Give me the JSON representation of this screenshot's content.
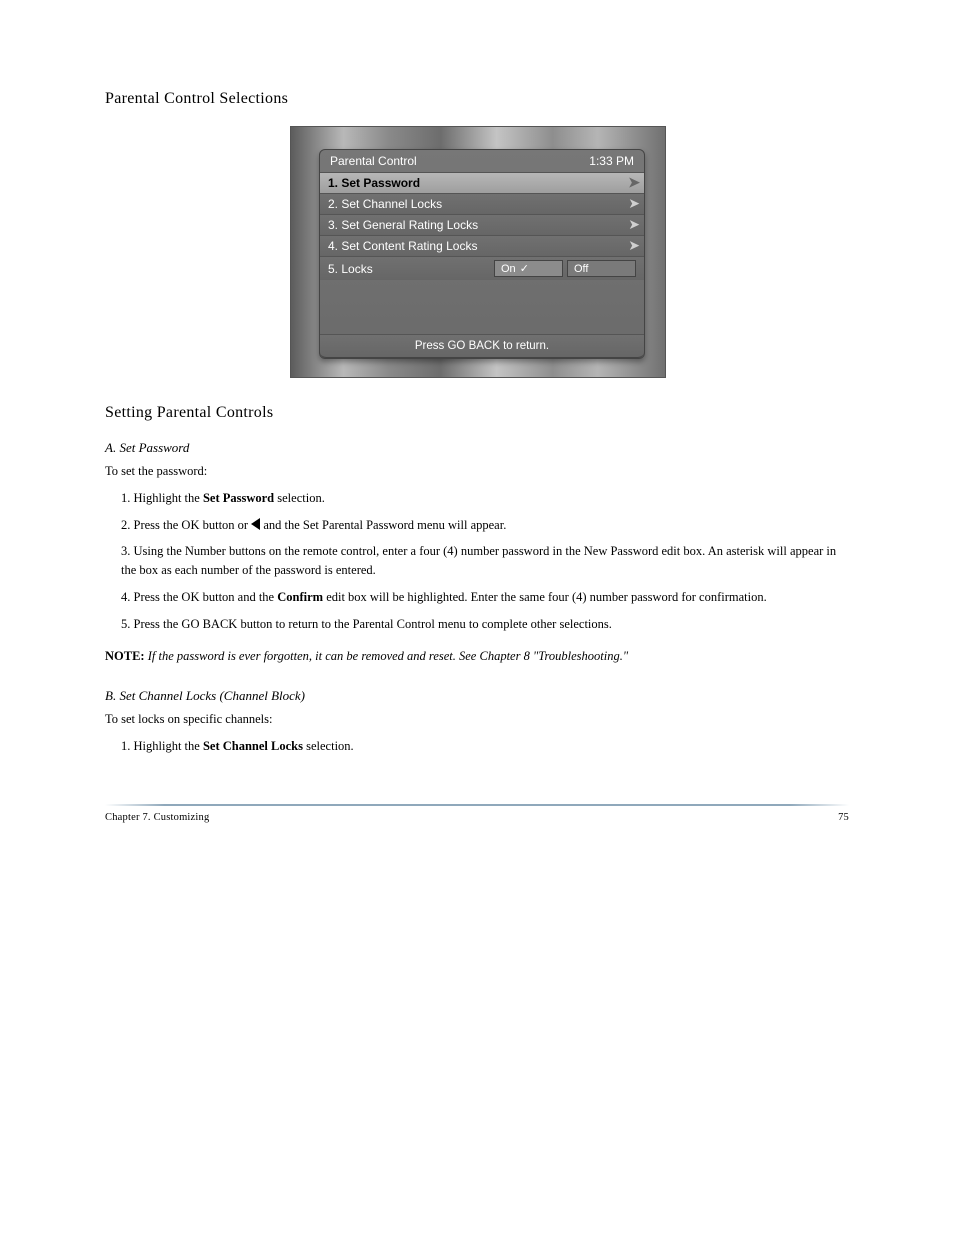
{
  "section1": {
    "title": "Parental Control Selections",
    "osd": {
      "header": "Parental Control",
      "time": "1:33 PM",
      "items": [
        {
          "n": "1.",
          "label": "Set Password",
          "selected": true
        },
        {
          "n": "2.",
          "label": "Set Channel Locks"
        },
        {
          "n": "3.",
          "label": "Set General Rating Locks"
        },
        {
          "n": "4.",
          "label": "Set Content Rating Locks"
        }
      ],
      "row5_num": "5.",
      "row5_label": "Locks",
      "row5_on": "On",
      "row5_off": "Off",
      "check": "✓",
      "footer": "Press GO BACK to return."
    }
  },
  "section2": {
    "heading": "Setting Parental Controls",
    "step_a_title": "A.  Set Password",
    "step_a_lead": "To set the password:",
    "step_a_1": "1.  Highlight the ",
    "step_a_1b": "Set Password",
    "step_a_1c": " selection.",
    "step_a_2_pre": "2.  Press the OK button or ",
    "step_a_2_post": " and the Set Parental Password menu will appear.",
    "step_a_3": "3.  Using the Number buttons on the remote control, enter a four (4) number password in the New Password edit box.  An asterisk will appear in the box as each number of the password is entered.",
    "step_a_4_a": "4.  Press the OK button and the ",
    "step_a_4_b": "Confirm",
    "step_a_4_c": " edit box will be highlighted.  Enter the same four (4) number password for confirmation.",
    "step_a_5": "5.  Press the GO BACK button to return to the Parental Control menu to complete other selections.",
    "note_label": "NOTE:",
    "note_body": " If the password is ever forgotten, it can be removed and reset.  See Chapter 8 \"Troubleshooting.\"",
    "step_b_title": "B.  Set Channel Locks (Channel Block)",
    "step_b_lead": "To set locks on specific channels:",
    "step_b_1_a": "1.  Highlight the ",
    "step_b_1_b": "Set Channel Locks",
    "step_b_1_c": " selection."
  },
  "footer": {
    "chapter": "Chapter 7.  Customizing",
    "page": "75"
  }
}
